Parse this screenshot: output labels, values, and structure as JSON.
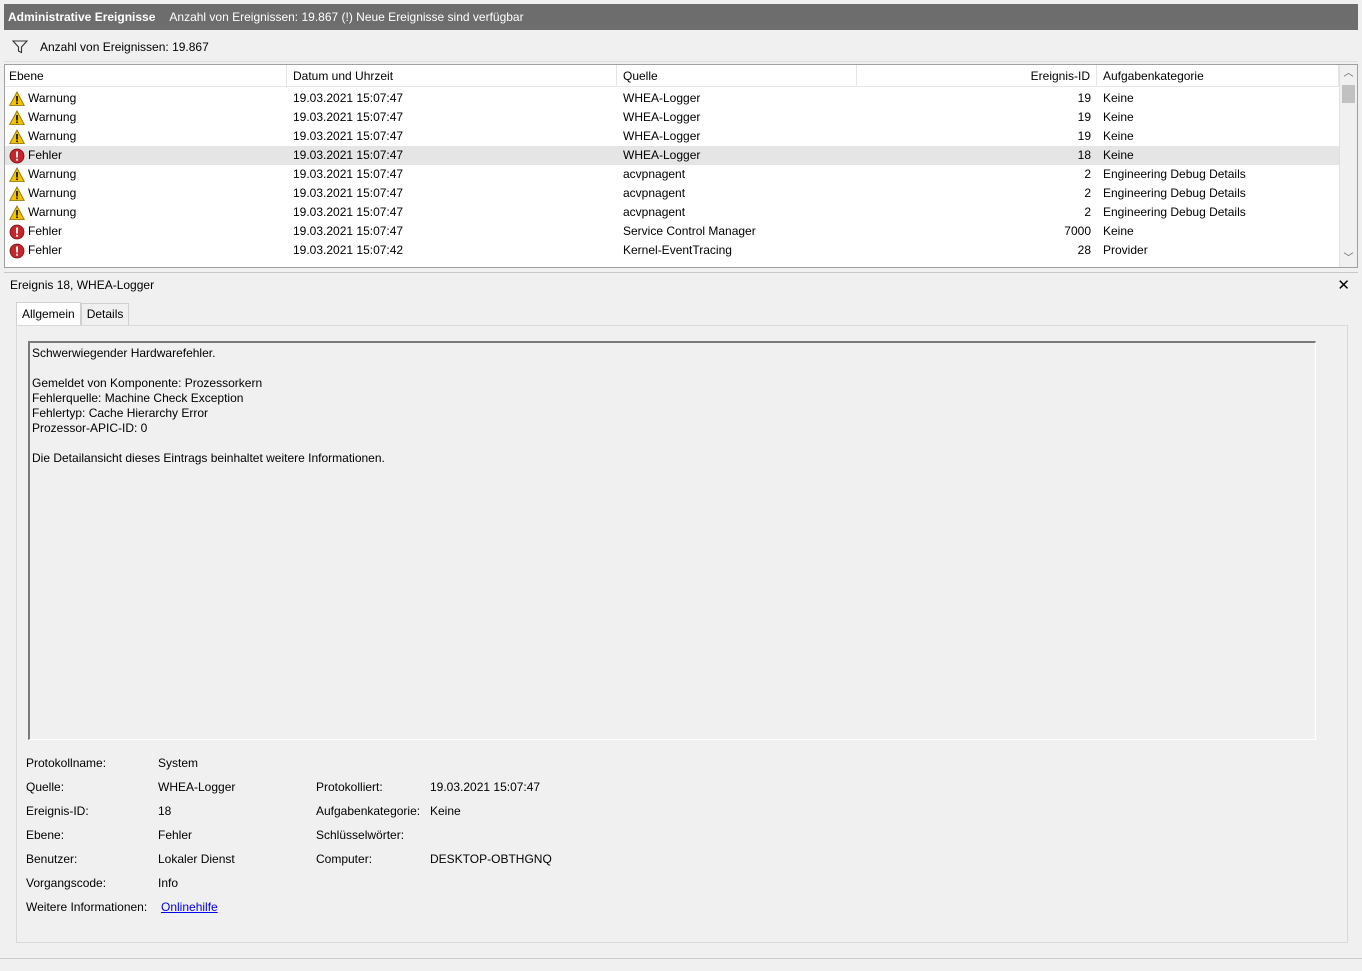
{
  "title": {
    "name": "Administrative Ereignisse",
    "info": "Anzahl von Ereignissen: 19.867 (!) Neue Ereignisse sind verfügbar"
  },
  "filter": {
    "icon": "filter-icon",
    "text": "Anzahl von Ereignissen: 19.867"
  },
  "columns": {
    "level": "Ebene",
    "date": "Datum und Uhrzeit",
    "source": "Quelle",
    "id": "Ereignis-ID",
    "category": "Aufgabenkategorie"
  },
  "events": [
    {
      "level": "Warnung",
      "icon": "warning-icon",
      "date": "19.03.2021 15:07:47",
      "source": "WHEA-Logger",
      "id": "19",
      "category": "Keine"
    },
    {
      "level": "Warnung",
      "icon": "warning-icon",
      "date": "19.03.2021 15:07:47",
      "source": "WHEA-Logger",
      "id": "19",
      "category": "Keine"
    },
    {
      "level": "Warnung",
      "icon": "warning-icon",
      "date": "19.03.2021 15:07:47",
      "source": "WHEA-Logger",
      "id": "19",
      "category": "Keine"
    },
    {
      "level": "Fehler",
      "icon": "error-icon",
      "date": "19.03.2021 15:07:47",
      "source": "WHEA-Logger",
      "id": "18",
      "category": "Keine"
    },
    {
      "level": "Warnung",
      "icon": "warning-icon",
      "date": "19.03.2021 15:07:47",
      "source": "acvpnagent",
      "id": "2",
      "category": "Engineering Debug Details"
    },
    {
      "level": "Warnung",
      "icon": "warning-icon",
      "date": "19.03.2021 15:07:47",
      "source": "acvpnagent",
      "id": "2",
      "category": "Engineering Debug Details"
    },
    {
      "level": "Warnung",
      "icon": "warning-icon",
      "date": "19.03.2021 15:07:47",
      "source": "acvpnagent",
      "id": "2",
      "category": "Engineering Debug Details"
    },
    {
      "level": "Fehler",
      "icon": "error-icon",
      "date": "19.03.2021 15:07:47",
      "source": "Service Control Manager",
      "id": "7000",
      "category": "Keine"
    },
    {
      "level": "Fehler",
      "icon": "error-icon",
      "date": "19.03.2021 15:07:42",
      "source": "Kernel-EventTracing",
      "id": "28",
      "category": "Provider"
    }
  ],
  "selected_row": 3,
  "detail": {
    "header": "Ereignis 18, WHEA-Logger",
    "tabs": [
      "Allgemein",
      "Details"
    ],
    "description": "Schwerwiegender Hardwarefehler.\n\nGemeldet von Komponente: Prozessorkern\nFehlerquelle: Machine Check Exception\nFehlertyp: Cache Hierarchy Error\nProzessor-APIC-ID: 0\n\nDie Detailansicht dieses Eintrags beinhaltet weitere Informationen.",
    "props": {
      "log_label": "Protokollname:",
      "log_value": "System",
      "source_label": "Quelle:",
      "source_value": "WHEA-Logger",
      "logged_label": "Protokolliert:",
      "logged_value": "19.03.2021 15:07:47",
      "id_label": "Ereignis-ID:",
      "id_value": "18",
      "category_label": "Aufgabenkategorie:",
      "category_value": "Keine",
      "level_label": "Ebene:",
      "level_value": "Fehler",
      "keywords_label": "Schlüsselwörter:",
      "keywords_value": "",
      "user_label": "Benutzer:",
      "user_value": "Lokaler Dienst",
      "computer_label": "Computer:",
      "computer_value": "DESKTOP-OBTHGNQ",
      "opcode_label": "Vorgangscode:",
      "opcode_value": "Info",
      "more_label": "Weitere Informationen:",
      "more_value": "Onlinehilfe"
    }
  },
  "colors": {
    "titlebar": "#6d6d6d",
    "selected_row": "#e5e5e5",
    "warning": "#f2c200",
    "error": "#c4262e",
    "link": "#0000ee"
  }
}
